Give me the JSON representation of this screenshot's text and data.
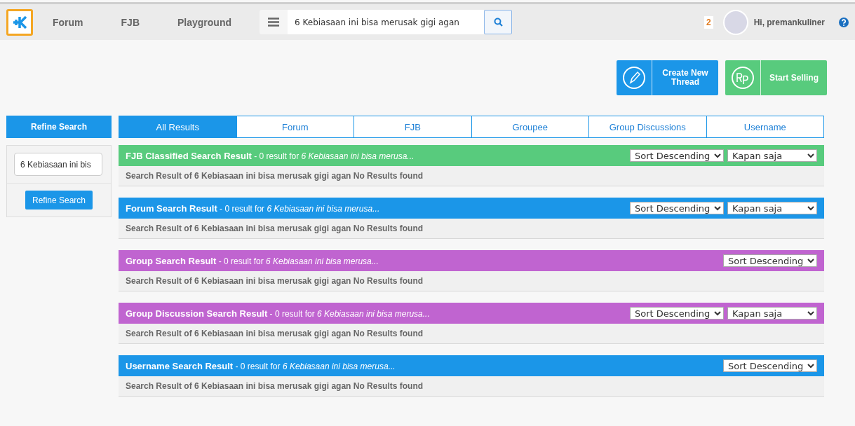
{
  "header": {
    "nav": [
      {
        "label": "Forum"
      },
      {
        "label": "FJB"
      },
      {
        "label": "Playground"
      }
    ],
    "search": {
      "value": "6 Kebiasaan ini bisa merusak gigi agan"
    },
    "notification_count": "2",
    "greeting": "Hi, premankuliner"
  },
  "actions": [
    {
      "kind": "thread",
      "label": "Create New Thread"
    },
    {
      "kind": "sell",
      "label": "Start Selling"
    }
  ],
  "sidebar": {
    "title": "Refine Search",
    "search": {
      "value": "6 Kebiasaan ini bis"
    },
    "button": "Refine Search"
  },
  "tabs": [
    {
      "label": "All Results",
      "selected": true
    },
    {
      "label": "Forum",
      "selected": false
    },
    {
      "label": "FJB",
      "selected": false
    },
    {
      "label": "Groupee",
      "selected": false
    },
    {
      "label": "Group Discussions",
      "selected": false
    },
    {
      "label": "Username",
      "selected": false
    }
  ],
  "sections": [
    {
      "title": "**FJB Classified Search Result** - 0 result for *6 Kebiasaan ini bisa merusa...*",
      "color": "#58cb7d",
      "dropdowns": [
        "Sort Descending",
        "Kapan saja"
      ],
      "message": "Search Result of 6 Kebiasaan ini bisa merusak gigi agan No Results found"
    },
    {
      "title": "**Forum Search Result** - 0 result for *6 Kebiasaan ini bisa merusa...*",
      "color": "#1b96e8",
      "dropdowns": [
        "Sort Descending",
        "Kapan saja"
      ],
      "message": "Search Result of 6 Kebiasaan ini bisa merusak gigi agan No Results found"
    },
    {
      "title": "**Group Search Result** - 0 result for *6 Kebiasaan ini bisa merusa...*",
      "color": "#c064d0",
      "dropdowns": [
        "Sort Descending"
      ],
      "message": "Search Result of 6 Kebiasaan ini bisa merusak gigi agan No Results found"
    },
    {
      "title": "**Group Discussion Search Result** - 0 result for *6 Kebiasaan ini bisa merusa...*",
      "color": "#c064d0",
      "dropdowns": [
        "Sort Descending",
        "Kapan saja"
      ],
      "message": "Search Result of 6 Kebiasaan ini bisa merusak gigi agan No Results found"
    },
    {
      "title": "**Username Search Result** - 0 result for *6 Kebiasaan ini bisa merusa...*",
      "color": "#1b96e8",
      "dropdowns": [
        "Sort Descending"
      ],
      "message": "Search Result of 6 Kebiasaan ini bisa merusak gigi agan No Results found"
    }
  ]
}
